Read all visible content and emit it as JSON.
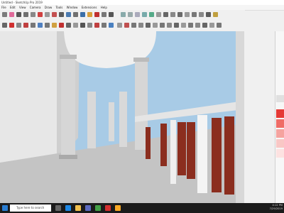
{
  "window": {
    "title": "Untitled - SketchUp Pro 2019"
  },
  "menu": [
    "File",
    "Edit",
    "View",
    "Camera",
    "Draw",
    "Tools",
    "Window",
    "Extensions",
    "Help"
  ],
  "search": {
    "placeholder": "Type here to search"
  },
  "clock": {
    "time": "4:12 PM",
    "date": "7/29/2019"
  },
  "colors": {
    "sky": "#a8cbe6",
    "floor": "#c4c4c4",
    "wall": "#e8e8e8",
    "column": "#cfcfcf",
    "baluster": "#8b2e1f",
    "taskbar": "#1b1b1b"
  },
  "icons": {
    "toolbar_row1": [
      "select-icon",
      "eraser-icon",
      "line-icon",
      "arc-icon",
      "rectangle-icon",
      "pushpull-icon",
      "move-icon",
      "rotate-icon",
      "scale-icon",
      "offset-icon",
      "tape-icon",
      "text-icon",
      "paint-icon",
      "orbit-icon",
      "pan-icon",
      "zoom-icon"
    ],
    "toolbar_row2": [
      "xray-icon",
      "wireframe-icon",
      "hidden-line-icon",
      "shaded-icon",
      "textured-icon",
      "monochrome-icon",
      "iso-icon",
      "top-icon",
      "front-icon",
      "right-icon",
      "back-icon",
      "left-icon",
      "warehouse-icon",
      "section-icon"
    ],
    "taskbar": [
      "start-icon",
      "task-view-icon",
      "edge-icon",
      "explorer-icon",
      "store-icon",
      "chrome-icon",
      "sketchup-icon",
      "files-icon"
    ]
  }
}
